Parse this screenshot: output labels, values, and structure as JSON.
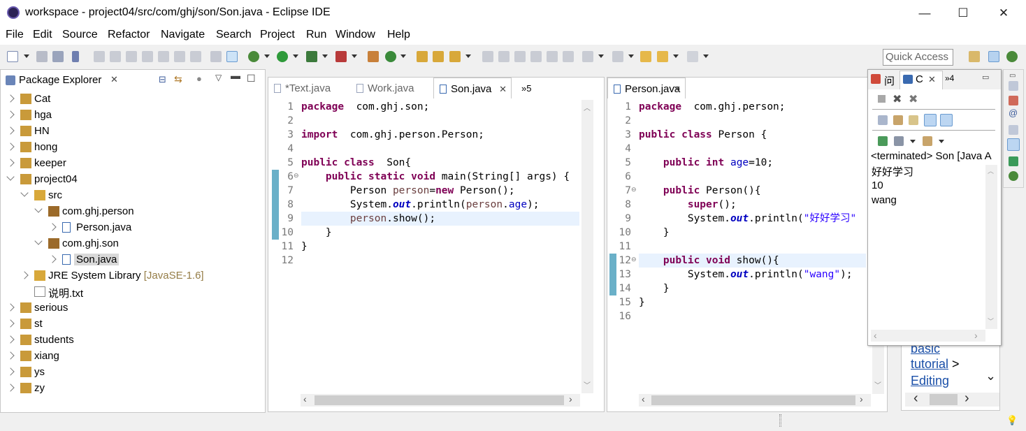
{
  "window": {
    "title": "workspace - project04/src/com/ghj/son/Son.java - Eclipse IDE",
    "minimize": "—",
    "maximize": "☐",
    "close": "✕"
  },
  "menu": [
    "File",
    "Edit",
    "Source",
    "Refactor",
    "Navigate",
    "Search",
    "Project",
    "Run",
    "Window",
    "Help"
  ],
  "quick_access": "Quick Access",
  "package_explorer": {
    "title": "Package Explorer",
    "items": [
      {
        "label": "Cat",
        "level": 0,
        "state": "closed"
      },
      {
        "label": "hga",
        "level": 0,
        "state": "closed"
      },
      {
        "label": "HN",
        "level": 0,
        "state": "closed"
      },
      {
        "label": "hong",
        "level": 0,
        "state": "closed"
      },
      {
        "label": "keeper",
        "level": 0,
        "state": "closed"
      },
      {
        "label": "project04",
        "level": 0,
        "state": "open"
      },
      {
        "label": "src",
        "level": 1,
        "state": "open"
      },
      {
        "label": "com.ghj.person",
        "level": 2,
        "state": "open"
      },
      {
        "label": "Person.java",
        "level": 3,
        "state": "closed"
      },
      {
        "label": "com.ghj.son",
        "level": 2,
        "state": "open"
      },
      {
        "label": "Son.java",
        "level": 3,
        "state": "closed"
      },
      {
        "label": "JRE System Library",
        "suffix": "[JavaSE-1.6]",
        "level": 1,
        "state": "closed"
      },
      {
        "label": "说明.txt",
        "level": 1,
        "state": "none"
      },
      {
        "label": "serious",
        "level": 0,
        "state": "closed"
      },
      {
        "label": "st",
        "level": 0,
        "state": "closed"
      },
      {
        "label": "students",
        "level": 0,
        "state": "closed"
      },
      {
        "label": "xiang",
        "level": 0,
        "state": "closed"
      },
      {
        "label": "ys",
        "level": 0,
        "state": "closed"
      },
      {
        "label": "zy",
        "level": 0,
        "state": "closed"
      }
    ]
  },
  "editor_left": {
    "tabs": [
      {
        "label": "*Text.java",
        "active": false
      },
      {
        "label": "Work.java",
        "active": false
      },
      {
        "label": "Son.java",
        "active": true
      }
    ],
    "overflow": "»5",
    "lines": [
      [
        [
          "kw",
          "package"
        ],
        [
          "",
          "  com.ghj.son;"
        ]
      ],
      [],
      [
        [
          "kw",
          "import"
        ],
        [
          "",
          "  com.ghj.person.Person;"
        ]
      ],
      [],
      [
        [
          "kw",
          "public class"
        ],
        [
          "",
          "  Son{"
        ]
      ],
      [
        [
          "",
          "    "
        ],
        [
          "kw",
          "public static void"
        ],
        [
          "",
          " main(String[] args) {"
        ]
      ],
      [
        [
          "",
          "        Person "
        ],
        [
          "var",
          "person"
        ],
        [
          "",
          "="
        ],
        [
          "kw",
          "new"
        ],
        [
          "",
          " Person();"
        ]
      ],
      [
        [
          "",
          "        System."
        ],
        [
          "sfld",
          "out"
        ],
        [
          "",
          ".println("
        ],
        [
          "var",
          "person"
        ],
        [
          "",
          "."
        ],
        [
          "fld",
          "age"
        ],
        [
          "",
          ");"
        ]
      ],
      [
        [
          "",
          "        "
        ],
        [
          "var",
          "person"
        ],
        [
          "",
          ".show();"
        ]
      ],
      [
        [
          "",
          "    }"
        ]
      ],
      [
        [
          "",
          "}"
        ]
      ],
      []
    ]
  },
  "editor_right": {
    "tabs": [
      {
        "label": "Person.java",
        "active": true
      }
    ],
    "lines": [
      [
        [
          "kw",
          "package"
        ],
        [
          "",
          "  com.ghj.person;"
        ]
      ],
      [],
      [
        [
          "kw",
          "public class"
        ],
        [
          "",
          " Person {"
        ]
      ],
      [],
      [
        [
          "",
          "    "
        ],
        [
          "kw",
          "public int"
        ],
        [
          "",
          " "
        ],
        [
          "fld",
          "age"
        ],
        [
          "",
          "=10;"
        ]
      ],
      [],
      [
        [
          "",
          "    "
        ],
        [
          "kw",
          "public"
        ],
        [
          "",
          " Person(){"
        ]
      ],
      [
        [
          "",
          "        "
        ],
        [
          "kw",
          "super"
        ],
        [
          "",
          "();"
        ]
      ],
      [
        [
          "",
          "        System."
        ],
        [
          "sfld",
          "out"
        ],
        [
          "",
          ".println("
        ],
        [
          "str",
          "\"好好学习\""
        ]
      ],
      [
        [
          "",
          "    }"
        ]
      ],
      [],
      [
        [
          "",
          "    "
        ],
        [
          "kw",
          "public void"
        ],
        [
          "",
          " show(){"
        ]
      ],
      [
        [
          "",
          "        System."
        ],
        [
          "sfld",
          "out"
        ],
        [
          "",
          ".println("
        ],
        [
          "str",
          "\"wang\""
        ],
        [
          "",
          ");"
        ]
      ],
      [
        [
          "",
          "    }"
        ]
      ],
      [
        [
          "",
          "}"
        ]
      ],
      []
    ]
  },
  "console": {
    "tabs": [
      {
        "label": "问",
        "active": false
      },
      {
        "label": "C",
        "active": true
      }
    ],
    "overflow": "»4",
    "header": "<terminated> Son [Java A",
    "output": [
      "好好学习",
      "10",
      "wang"
    ]
  },
  "help": {
    "lines": [
      "basic",
      "tutorial",
      "Editing"
    ],
    "sep": ">"
  }
}
